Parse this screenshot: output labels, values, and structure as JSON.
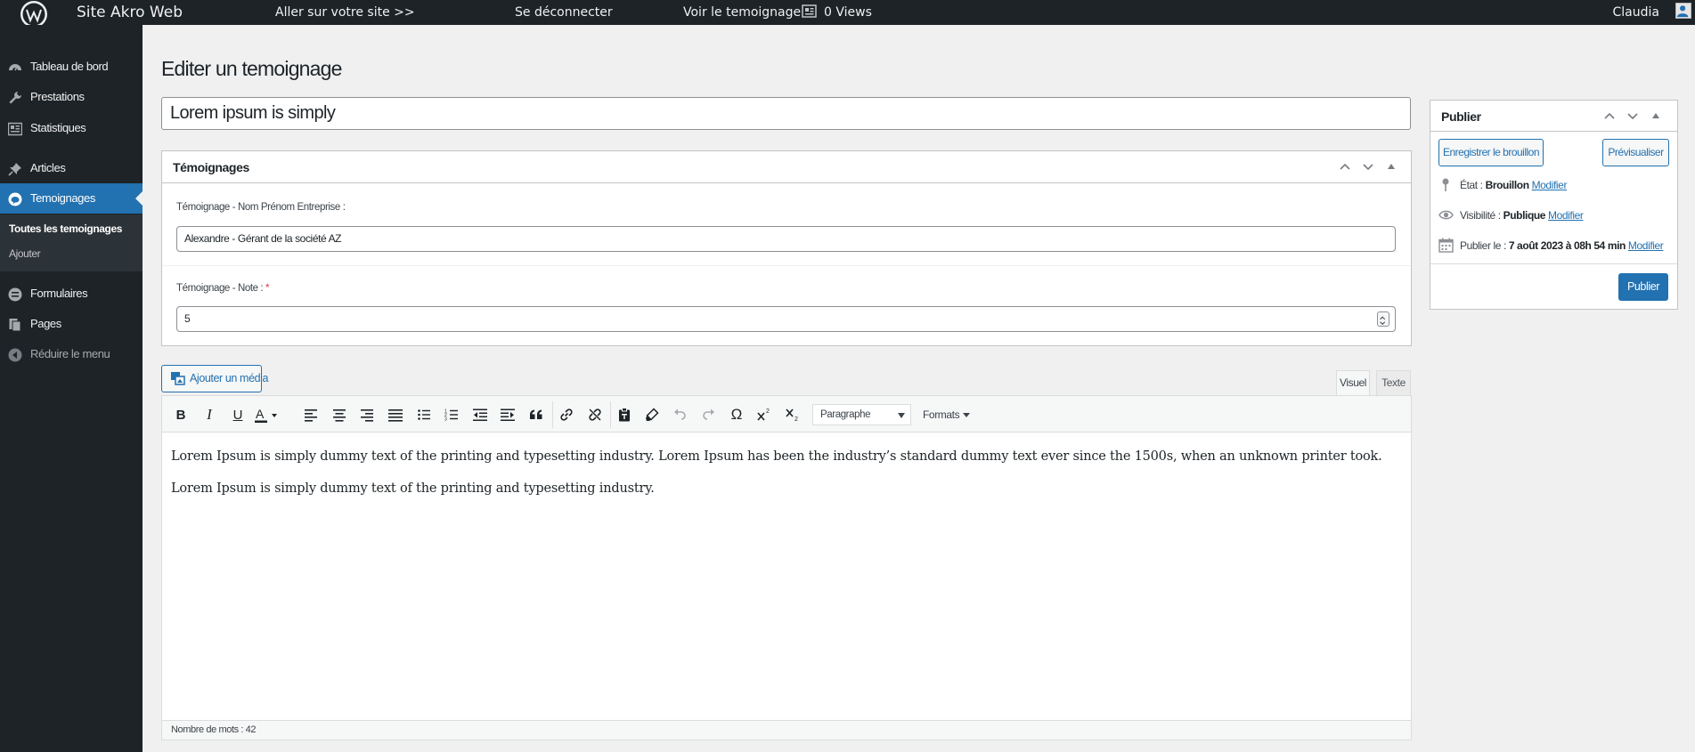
{
  "adminbar": {
    "site_name": "Site Akro Web",
    "visit_site": "Aller sur votre site >>",
    "logout": "Se déconnecter",
    "view_item": "Voir le temoignage",
    "views": "0 Views",
    "user": "Claudia"
  },
  "sidebar": {
    "items": [
      {
        "label": "Tableau de bord",
        "icon": "dashboard-icon"
      },
      {
        "label": "Prestations",
        "icon": "wrench-icon"
      },
      {
        "label": "Statistiques",
        "icon": "statistics-icon"
      },
      {
        "label": "Articles",
        "icon": "pushpin-icon"
      },
      {
        "label": "Temoignages",
        "icon": "testimonial-icon"
      },
      {
        "label": "Formulaires",
        "icon": "forms-icon"
      },
      {
        "label": "Pages",
        "icon": "pages-icon"
      },
      {
        "label": "Réduire le menu",
        "icon": "collapse-icon"
      }
    ],
    "submenu": [
      "Toutes les temoignages",
      "Ajouter"
    ],
    "accent_color": "#2271b1"
  },
  "main": {
    "page_title": "Editer un temoignage",
    "post_title": "Lorem ipsum is simply"
  },
  "testimonial_box": {
    "title": "Témoignages",
    "name_label": "Témoignage - Nom Prénom Entreprise :",
    "name_value": "Alexandre - Gérant de la société AZ",
    "note_label": "Témoignage - Note :",
    "note_required": "*",
    "note_value": "5"
  },
  "editor": {
    "add_media": "Ajouter un média",
    "tab_visual": "Visuel",
    "tab_text": "Texte",
    "format": "Paragraphe",
    "formats": "Formats",
    "paragraphs": [
      "Lorem Ipsum is simply dummy text of the printing and typesetting industry. Lorem Ipsum has been the industry’s standard dummy text ever since the 1500s, when an unknown printer took.",
      "Lorem Ipsum is simply dummy text of the printing and typesetting industry."
    ],
    "word_count": "Nombre de mots : 42"
  },
  "publish": {
    "title": "Publier",
    "save_draft": "Enregistrer le brouillon",
    "preview": "Prévisualiser",
    "status_label": "État : ",
    "status_value": "Brouillon",
    "visibility_label": "Visibilité : ",
    "visibility_value": "Publique",
    "date_label": "Publier le : ",
    "date_value": "7 août 2023 à 08h 54 min",
    "edit_link": "Modifier",
    "publish_button": "Publier"
  }
}
